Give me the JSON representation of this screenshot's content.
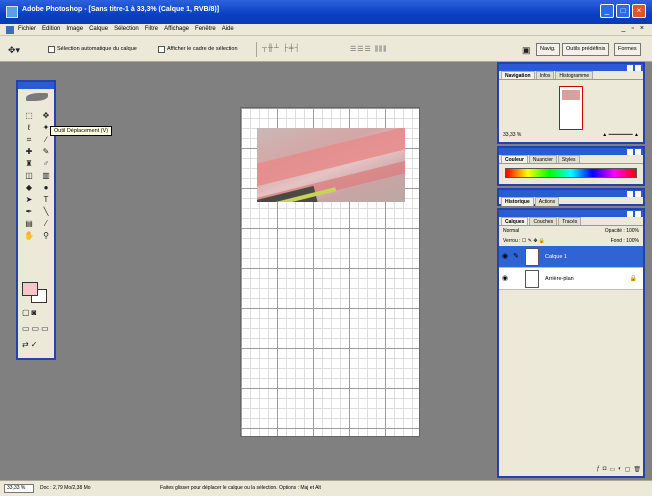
{
  "window": {
    "title": "Adobe Photoshop - [Sans titre-1 à 33,3% (Calque 1, RVB/8)]",
    "buttons": {
      "minimize": "_",
      "maximize": "□",
      "close": "×"
    }
  },
  "menubar": {
    "items": [
      "Fichier",
      "Edition",
      "Image",
      "Calque",
      "Sélection",
      "Filtre",
      "Affichage",
      "Fenêtre",
      "Aide"
    ],
    "mdi": {
      "minimize": "_",
      "restore": "▫",
      "close": "×"
    }
  },
  "options": {
    "auto_select_label": "Sélection automatique du calque",
    "bounding_box_label": "Afficher le cadre de sélection",
    "file_browser_label": "Navig.",
    "palette_label": "Outils prédéfinis",
    "brushes_label": "Formes"
  },
  "tooltip": "Outil Déplacement (V)",
  "navigator": {
    "tabs": [
      "Navigation",
      "Infos",
      "Histogramme"
    ],
    "zoom": "33,33 %"
  },
  "color": {
    "tabs": [
      "Couleur",
      "Nuancier",
      "Styles"
    ]
  },
  "history": {
    "tabs": [
      "Historique",
      "Actions"
    ]
  },
  "layers": {
    "tabs": [
      "Calques",
      "Couches",
      "Tracés"
    ],
    "blend_mode": "Normal",
    "opacity_label": "Opacité :",
    "opacity_value": "100%",
    "lock_label": "Verrou :",
    "fill_label": "Fond :",
    "fill_value": "100%",
    "rows": [
      {
        "name": "Calque 1",
        "selected": true
      },
      {
        "name": "Arrière-plan",
        "selected": false
      }
    ]
  },
  "statusbar": {
    "zoom": "33,33 %",
    "doc": "Doc : 2,79 Mo/2,38 Mo",
    "tip": "Faites glisser pour déplacer le calque ou la sélection. Options : Maj et Alt"
  },
  "colors": {
    "titlebar": "#0a3fc4",
    "foreground_swatch": "#f7c7c7",
    "selected_layer": "#3063d4"
  }
}
